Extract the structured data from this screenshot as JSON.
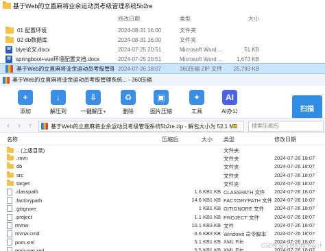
{
  "explorer": {
    "title": "基于Web的立直麻将业余运动员考级管理系统5b2re",
    "headers": {
      "name": "",
      "date": "修改日期",
      "type": "类型",
      "size": "大小"
    },
    "rows": [
      {
        "icon": "folder-icon",
        "name": "01 配置环境",
        "date": "2024-08-31 16:00",
        "type": "文件夹",
        "size": ""
      },
      {
        "icon": "folder-icon",
        "name": "02 db数据库",
        "date": "2024-08-31 16:00",
        "type": "文件夹",
        "size": ""
      },
      {
        "icon": "word-doc-icon",
        "name": "biye论文.docx",
        "date": "2024-07-25 20:51",
        "type": "Microsoft Word ...",
        "size": "51 KB"
      },
      {
        "icon": "word-doc-icon",
        "name": "springboot+vue环境配置文档.docx",
        "date": "2024-07-25 20:51",
        "type": "Microsoft Word ...",
        "size": "1,673 KB"
      },
      {
        "icon": "zip-archive-icon",
        "name": "基于Web的立直麻将业余运动员考级管理...",
        "date": "2024-07-26 18:07",
        "type": "360压缩 ZIP 文件",
        "size": "25,793 KB",
        "selected": true
      }
    ]
  },
  "zipwin": {
    "title": "基于Web的立直麻将业余运动员考级管理系统... - 360压缩",
    "tools": [
      {
        "label": "添加",
        "icon": "add-icon",
        "color": "#3a8ee6"
      },
      {
        "label": "解压到",
        "icon": "extract-to-icon",
        "color": "#3a8ee6"
      },
      {
        "label": "一键解压",
        "icon": "one-click-extract-icon",
        "color": "#3a8ee6"
      },
      {
        "label": "删除",
        "icon": "delete-icon",
        "color": "#3a8ee6"
      },
      {
        "label": "图片压缩",
        "icon": "image-compress-icon",
        "color": "#3a8ee6"
      },
      {
        "label": "工具",
        "icon": "tools-icon",
        "color": "#3a8ee6"
      },
      {
        "label": "AI办公",
        "icon": "ai-office-icon",
        "color": "#4a63e8"
      }
    ],
    "scan_label": "扫描",
    "path": "基于Web的立直麻将业余运动员考级管理系统5b2re.zip - 解包大小为 52.1 MB",
    "search_placeholder": "搜索压缩包",
    "headers": {
      "name": "名称",
      "compressed": "压缩后",
      "size": "大小",
      "type": "类型",
      "date": "修改日期"
    },
    "rows": [
      {
        "icon": "folder-icon",
        "name": ".. (上级目录)",
        "compressed": "",
        "size": "",
        "type": "文件夹",
        "date": ""
      },
      {
        "icon": "folder-icon",
        "name": ".mvn",
        "compressed": "",
        "size": "",
        "type": "文件夹",
        "date": "2024-07-26 18:07"
      },
      {
        "icon": "folder-icon",
        "name": "db",
        "compressed": "",
        "size": "",
        "type": "文件夹",
        "date": "2024-07-26 18:07"
      },
      {
        "icon": "folder-icon",
        "name": "src",
        "compressed": "",
        "size": "",
        "type": "文件夹",
        "date": "2024-07-26 18:07"
      },
      {
        "icon": "folder-icon",
        "name": "target",
        "compressed": "",
        "size": "",
        "type": "文件夹",
        "date": "2024-07-26 18:07"
      },
      {
        "icon": "file-icon",
        "name": ".classpath",
        "compressed": "1.6 KB",
        "size": "1 KB",
        "type": "CLASSPATH 文件",
        "date": "2024-07-26 18:07"
      },
      {
        "icon": "file-icon",
        "name": ".factorypath",
        "compressed": "14.6 KB",
        "size": "1 KB",
        "type": "FACTORYPATH 文件",
        "date": "2024-07-26 18:07"
      },
      {
        "icon": "file-icon",
        "name": ".gitignore",
        "compressed": "1 KB",
        "size": "1 KB",
        "type": "GITIGNORE 文件",
        "date": "2024-07-26 18:07"
      },
      {
        "icon": "file-icon",
        "name": ".project",
        "compressed": "1.1 KB",
        "size": "1 KB",
        "type": "PROJECT 文件",
        "date": "2024-07-26 18:07"
      },
      {
        "icon": "file-icon",
        "name": "mvnw",
        "compressed": "10.1 KB",
        "size": "3 KB",
        "type": "文件",
        "date": "2024-07-26 18:07"
      },
      {
        "icon": "file-icon",
        "name": "mvnw.cmd",
        "compressed": "6.6 KB",
        "size": "3 KB",
        "type": "Windows 命令脚本",
        "date": "2024-07-26 18:07"
      },
      {
        "icon": "file-icon",
        "name": "pom.xml",
        "compressed": "5.1 KB",
        "size": "1 KB",
        "type": "XML File",
        "date": "2024-07-26 18:07"
      },
      {
        "icon": "file-icon",
        "name": "pom-war.xml",
        "compressed": "5.5 KB",
        "size": "1 KB",
        "type": "XML File",
        "date": "2024-07-26 18:07"
      }
    ]
  },
  "watermark": "CSDN @计算机程序设计"
}
